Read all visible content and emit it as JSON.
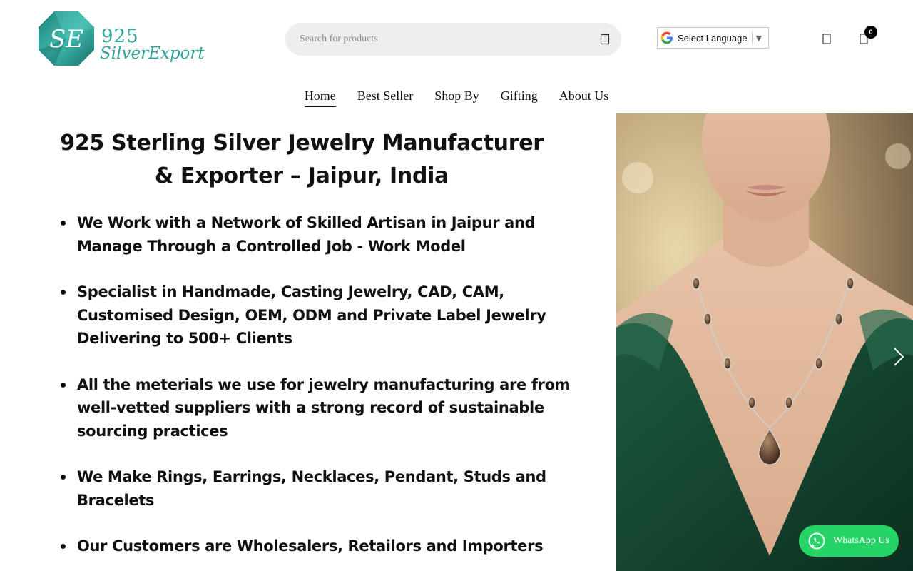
{
  "brand": {
    "number": "925",
    "name": "SilverExport",
    "monogram": "SE",
    "color": "#2fa39a"
  },
  "search": {
    "placeholder": "Search for products",
    "icon": "search-icon"
  },
  "language": {
    "label": "Select Language",
    "arrow": "▼",
    "icon": "google-g-icon"
  },
  "header_icons": {
    "account": "user-icon",
    "cart": "cart-icon",
    "cart_count": "0"
  },
  "nav": {
    "items": [
      {
        "label": "Home"
      },
      {
        "label": "Best Seller"
      },
      {
        "label": "Shop By"
      },
      {
        "label": "Gifting"
      },
      {
        "label": "About Us"
      }
    ]
  },
  "hero": {
    "title_line1": "925 Sterling Silver Jewelry Manufacturer",
    "title_line2": "& Exporter – Jaipur, India",
    "bullets": [
      "We Work with a Network of Skilled Artisan in Jaipur and Manage Through a Controlled Job - Work Model",
      "Specialist in Handmade, Casting Jewelry, CAD, CAM, Customised Design, OEM, ODM and Private Label Jewelry Delivering to 500+ Clients",
      "All the meterials we use for jewelry manufacturing are from well-vetted suppliers with a strong record of sustainable sourcing practices",
      "We Make Rings, Earrings, Necklaces, Pendant, Studs and Bracelets",
      "Our Customers are Wholesalers, Retailors and Importers"
    ],
    "image": "woman-wearing-smoky-quartz-necklace",
    "slider_icon": "chevron-right-icon"
  },
  "whatsapp": {
    "label": "WhatsApp Us",
    "icon": "whatsapp-icon",
    "color": "#25d366"
  }
}
